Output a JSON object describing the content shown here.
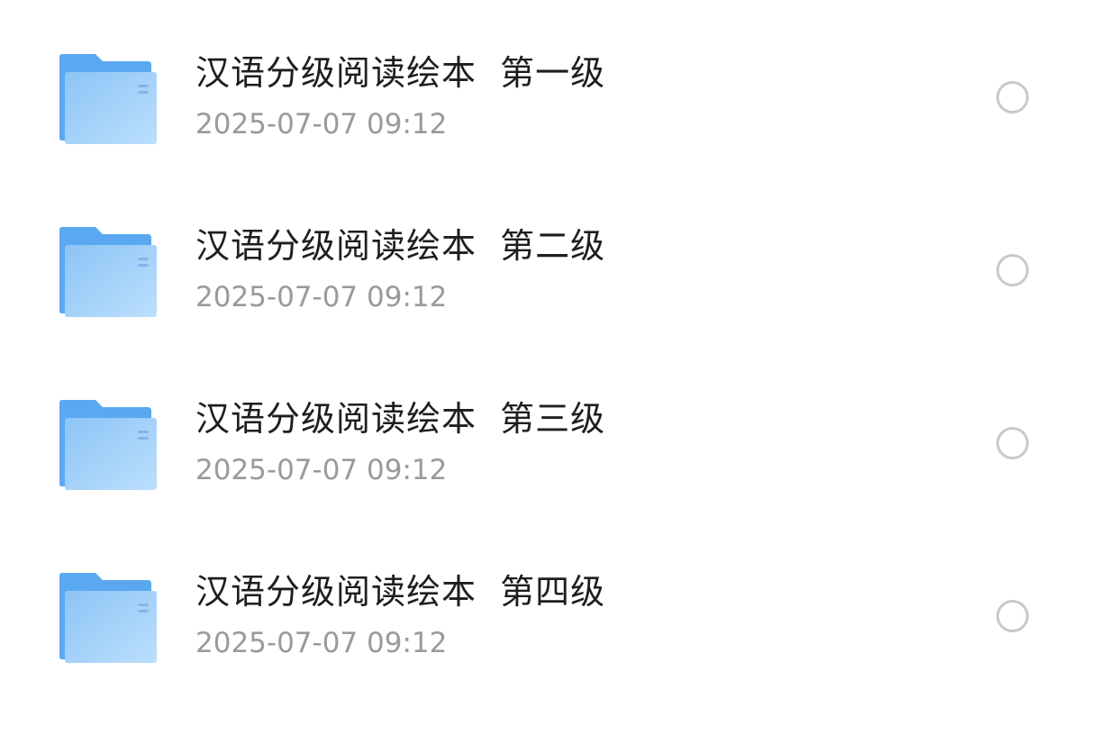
{
  "files": [
    {
      "name": "汉语分级阅读绘本  第一级",
      "modified": "2025-07-07 09:12",
      "icon": "folder-icon",
      "selected": false
    },
    {
      "name": "汉语分级阅读绘本  第二级",
      "modified": "2025-07-07 09:12",
      "icon": "folder-icon",
      "selected": false
    },
    {
      "name": "汉语分级阅读绘本  第三级",
      "modified": "2025-07-07 09:12",
      "icon": "folder-icon",
      "selected": false
    },
    {
      "name": "汉语分级阅读绘本  第四级",
      "modified": "2025-07-07 09:12",
      "icon": "folder-icon",
      "selected": false
    }
  ],
  "colors": {
    "folder_back": "#5aa9f0",
    "folder_front_light": "#b6dbfb",
    "folder_front_dark": "#8cc4f6",
    "title_text": "#1e1e1e",
    "date_text": "#9a9a9a",
    "radio_border": "#c9c9c9"
  }
}
